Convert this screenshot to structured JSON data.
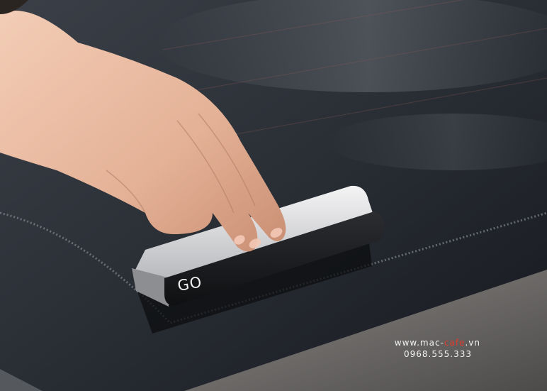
{
  "device": {
    "label": "GO"
  },
  "watermark": {
    "site_prefix": "www.mac-",
    "site_accent": "cafe",
    "site_suffix": ".vn",
    "phone": "0968.555.333",
    "accent_color": "#e23b2a"
  },
  "colors": {
    "glass": "#1f242b",
    "glass_reflection": "#5a6068",
    "dashboard": "#6f6c6a",
    "skin": "#e8b9a0",
    "device_black": "#1c1d20",
    "device_silver": "#d9d9db"
  }
}
